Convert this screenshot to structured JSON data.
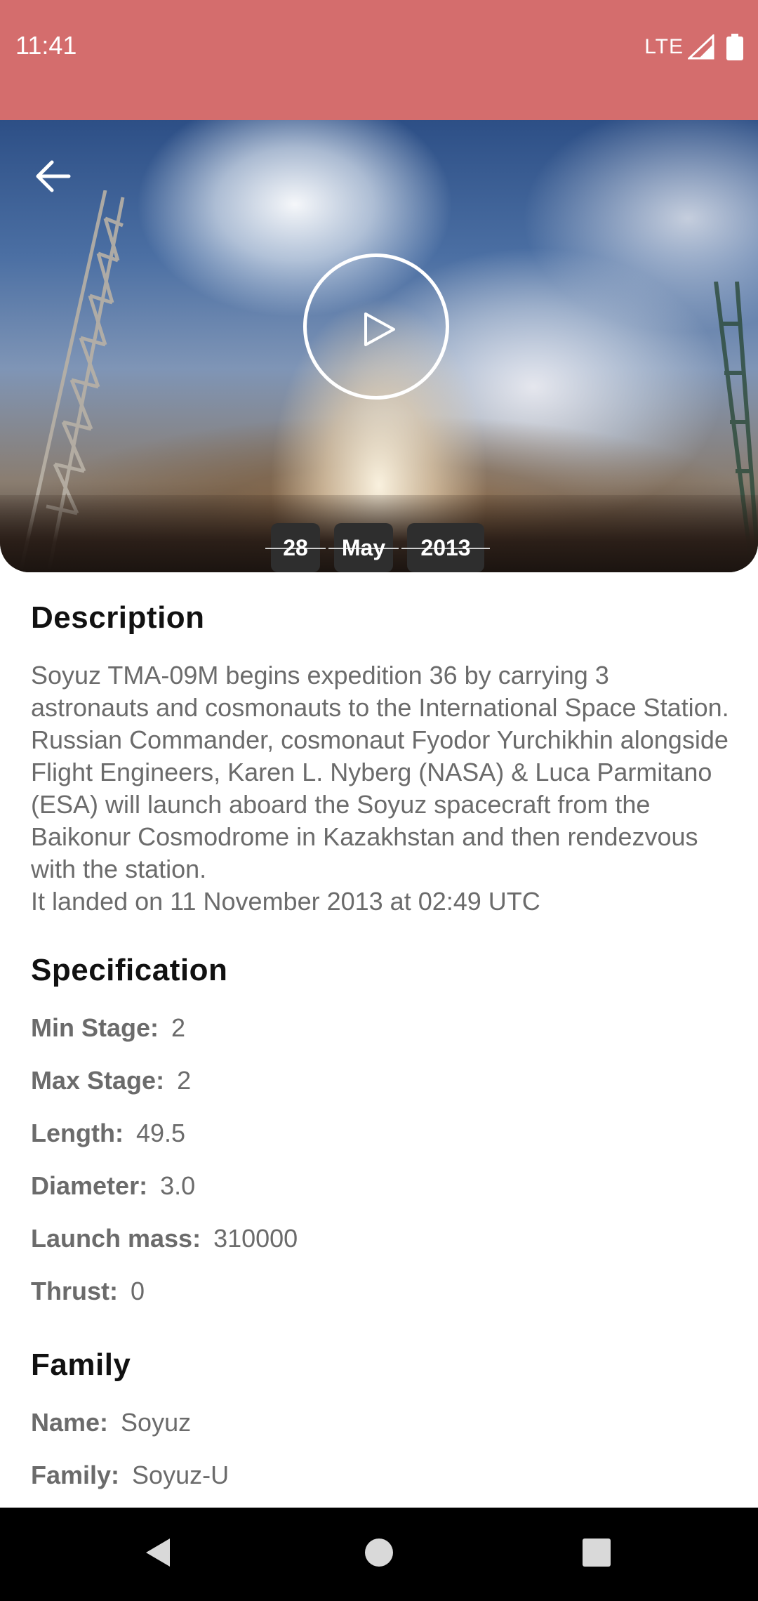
{
  "status_bar": {
    "time": "11:41",
    "network": "LTE"
  },
  "hero": {
    "back_icon": "arrow-left-icon",
    "play_icon": "play-icon",
    "date": {
      "day": "28",
      "month": "May",
      "year": "2013"
    }
  },
  "description": {
    "title": "Description",
    "text": "Soyuz TMA-09M begins expedition 36 by carrying 3 astronauts and cosmonauts to the International Space Station.\nRussian Commander, cosmonaut Fyodor Yurchikhin alongside Flight Engineers, Karen L. Nyberg (NASA) & Luca Parmitano (ESA) will launch aboard the Soyuz spacecraft from the Baikonur Cosmodrome in Kazakhstan and then rendezvous with the station.\nIt landed on 11 November 2013 at 02:49 UTC"
  },
  "specification": {
    "title": "Specification",
    "items": [
      {
        "label": "Min Stage:",
        "value": "2"
      },
      {
        "label": "Max Stage:",
        "value": "2"
      },
      {
        "label": "Length:",
        "value": "49.5"
      },
      {
        "label": "Diameter:",
        "value": "3.0"
      },
      {
        "label": "Launch mass:",
        "value": "310000"
      },
      {
        "label": "Thrust:",
        "value": "0"
      }
    ]
  },
  "family": {
    "title": "Family",
    "items": [
      {
        "label": "Name:",
        "value": "Soyuz"
      },
      {
        "label": "Family:",
        "value": "Soyuz-U"
      }
    ]
  },
  "colors": {
    "status_bar": "#d46d6d",
    "text_gray": "#6b6b6b",
    "chip": "#2e2e2e"
  }
}
